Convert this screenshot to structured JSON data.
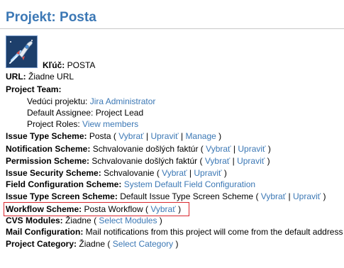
{
  "project": {
    "title": "Projekt: Posta",
    "key_label": "Kľúč:",
    "key_value": "POSTA"
  },
  "url": {
    "label": "URL:",
    "value": "Žiadne URL"
  },
  "team": {
    "label": "Project Team:",
    "lead_label": "Vedúci projektu:",
    "lead_value": "Jira Administrator",
    "assignee_label": "Default Assignee:",
    "assignee_value": "Project Lead",
    "roles_label": "Project Roles:",
    "roles_link": "View members"
  },
  "actions": {
    "select": "Vybrať",
    "edit": "Upraviť",
    "manage": "Manage",
    "select_modules": "Select Modules",
    "select_category": "Select Category"
  },
  "schemes": {
    "issue_type": {
      "label": "Issue Type Scheme:",
      "value": "Posta"
    },
    "notification": {
      "label": "Notification Scheme:",
      "value": "Schvalovanie došlých faktúr"
    },
    "permission": {
      "label": "Permission Scheme:",
      "value": "Schvalovanie došlých faktúr"
    },
    "issue_security": {
      "label": "Issue Security Scheme:",
      "value": "Schvalovanie"
    },
    "field_configuration": {
      "label": "Field Configuration Scheme:",
      "value": "System Default Field Configuration"
    },
    "issue_type_screen": {
      "label": "Issue Type Screen Scheme:",
      "value": "Default Issue Type Screen Scheme"
    },
    "workflow": {
      "label": "Workflow Scheme:",
      "value": "Posta Workflow"
    }
  },
  "cvs": {
    "label": "CVS Modules:",
    "value": "Žiadne"
  },
  "mail": {
    "label": "Mail Configuration:",
    "value": "Mail notifications from this project will come from the default address"
  },
  "category": {
    "label": "Project Category:",
    "value": "Žiadne"
  },
  "colors": {
    "title": "#3c78b5",
    "link": "#3c78b5",
    "highlight_box": "#d9272e"
  }
}
